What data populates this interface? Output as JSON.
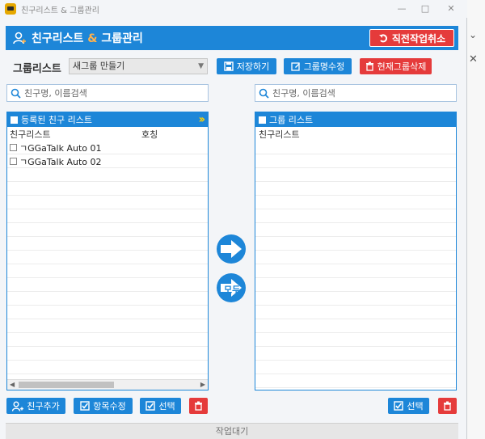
{
  "window": {
    "title": "친구리스트 & 그룹관리"
  },
  "header": {
    "title_part1": "친구리스트",
    "title_amp": " & ",
    "title_part2": "그룹관리",
    "undo_label": "직전작업취소"
  },
  "group": {
    "label": "그룹리스트",
    "selected": "새그룹 만들기",
    "save_label": "저장하기",
    "rename_label": "그룹명수정",
    "delete_label": "현재그룹삭제"
  },
  "search_left": {
    "placeholder": "친구명, 이름검색"
  },
  "search_right": {
    "placeholder": "친구명, 이름검색"
  },
  "left_panel": {
    "header": "등록된 친구 리스트",
    "columns": [
      "친구리스트",
      "호칭"
    ],
    "rows": [
      "ㄱGGaTalk Auto 01",
      "ㄱGGaTalk Auto 02"
    ]
  },
  "right_panel": {
    "header": "그룹 리스트",
    "columns": [
      "친구리스트"
    ]
  },
  "transfer": {
    "all_label": "모두"
  },
  "bottom_left": {
    "add_friend": "친구추가",
    "edit_items": "항목수정",
    "select": "선택"
  },
  "bottom_right": {
    "select": "선택"
  },
  "status": {
    "text": "작업대기"
  },
  "colors": {
    "primary": "#1d86d8",
    "danger": "#e53b3b",
    "accent": "#ffb24d"
  }
}
